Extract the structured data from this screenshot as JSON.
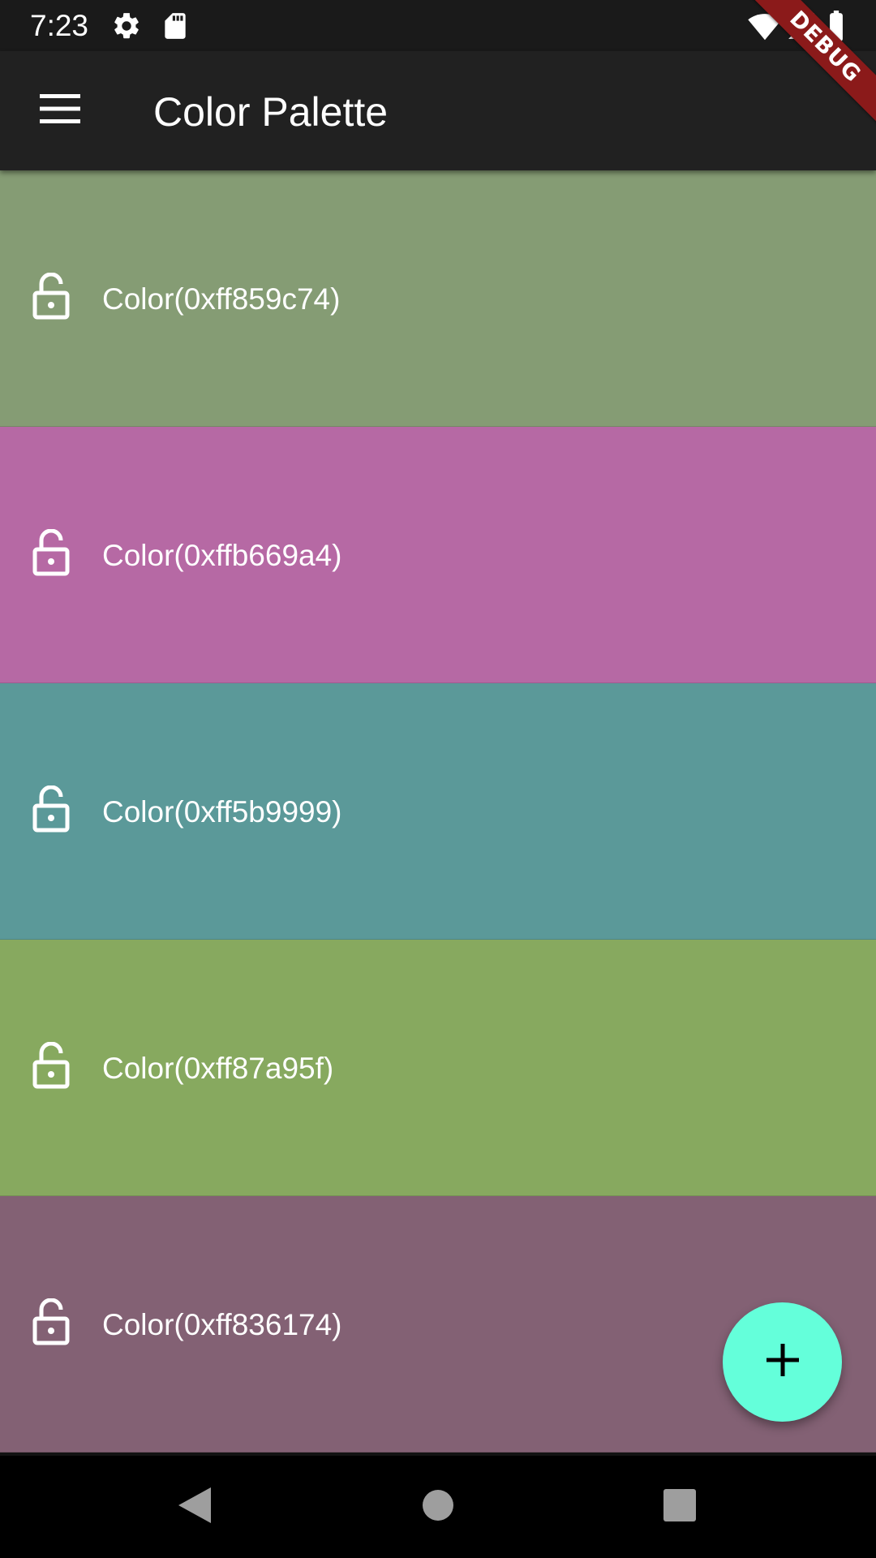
{
  "status_bar": {
    "time": "7:23",
    "left_icons": [
      "gear-icon",
      "sd-card-icon"
    ],
    "right_icons": [
      "wifi-icon",
      "signal-icon",
      "battery-icon"
    ]
  },
  "app_bar": {
    "title": "Color Palette",
    "menu_icon": "hamburger-menu-icon"
  },
  "debug_banner": {
    "label": "DEBUG",
    "color": "#8b1a1a"
  },
  "color_list": [
    {
      "label": "Color(0xff859c74)",
      "hex": "#859c74",
      "locked": false
    },
    {
      "label": "Color(0xffb669a4)",
      "hex": "#b669a4",
      "locked": false
    },
    {
      "label": "Color(0xff5b9999)",
      "hex": "#5b9999",
      "locked": false
    },
    {
      "label": "Color(0xff87a95f)",
      "hex": "#87a95f",
      "locked": false
    },
    {
      "label": "Color(0xff836174)",
      "hex": "#836174",
      "locked": false
    }
  ],
  "fab": {
    "icon": "plus-icon",
    "color": "#64ffda"
  },
  "nav_bar": {
    "buttons": [
      "back-icon",
      "home-icon",
      "recents-icon"
    ]
  }
}
